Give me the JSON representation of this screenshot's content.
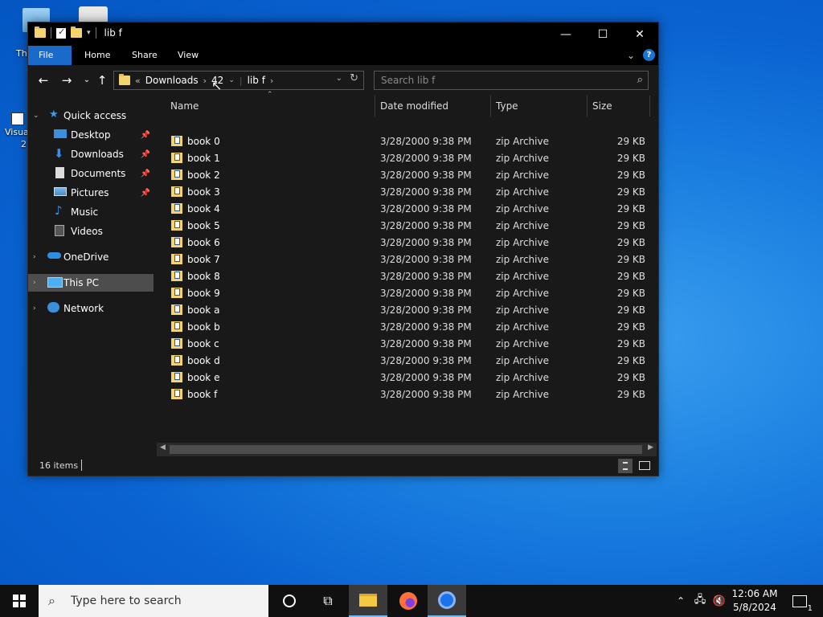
{
  "desktop": {
    "icon_labels": [
      "Th",
      "Visua",
      "2"
    ]
  },
  "window": {
    "title": "lib f",
    "minimize": "—",
    "maximize": "☐",
    "close": "✕"
  },
  "ribbon": {
    "tabs": [
      "File",
      "Home",
      "Share",
      "View"
    ],
    "help": "?"
  },
  "address": {
    "overflow": "«",
    "crumbs": [
      "Downloads",
      "42",
      "lib f"
    ],
    "separator": "›"
  },
  "search": {
    "placeholder": "Search lib f"
  },
  "navpane": {
    "quick_access": "Quick access",
    "desktop": "Desktop",
    "downloads": "Downloads",
    "documents": "Documents",
    "pictures": "Pictures",
    "music": "Music",
    "videos": "Videos",
    "onedrive": "OneDrive",
    "this_pc": "This PC",
    "network": "Network"
  },
  "columns": {
    "name": "Name",
    "date": "Date modified",
    "type": "Type",
    "size": "Size"
  },
  "files": [
    {
      "name": "book 0",
      "date": "3/28/2000 9:38 PM",
      "type": "zip Archive",
      "size": "29 KB"
    },
    {
      "name": "book 1",
      "date": "3/28/2000 9:38 PM",
      "type": "zip Archive",
      "size": "29 KB"
    },
    {
      "name": "book 2",
      "date": "3/28/2000 9:38 PM",
      "type": "zip Archive",
      "size": "29 KB"
    },
    {
      "name": "book 3",
      "date": "3/28/2000 9:38 PM",
      "type": "zip Archive",
      "size": "29 KB"
    },
    {
      "name": "book 4",
      "date": "3/28/2000 9:38 PM",
      "type": "zip Archive",
      "size": "29 KB"
    },
    {
      "name": "book 5",
      "date": "3/28/2000 9:38 PM",
      "type": "zip Archive",
      "size": "29 KB"
    },
    {
      "name": "book 6",
      "date": "3/28/2000 9:38 PM",
      "type": "zip Archive",
      "size": "29 KB"
    },
    {
      "name": "book 7",
      "date": "3/28/2000 9:38 PM",
      "type": "zip Archive",
      "size": "29 KB"
    },
    {
      "name": "book 8",
      "date": "3/28/2000 9:38 PM",
      "type": "zip Archive",
      "size": "29 KB"
    },
    {
      "name": "book 9",
      "date": "3/28/2000 9:38 PM",
      "type": "zip Archive",
      "size": "29 KB"
    },
    {
      "name": "book a",
      "date": "3/28/2000 9:38 PM",
      "type": "zip Archive",
      "size": "29 KB"
    },
    {
      "name": "book b",
      "date": "3/28/2000 9:38 PM",
      "type": "zip Archive",
      "size": "29 KB"
    },
    {
      "name": "book c",
      "date": "3/28/2000 9:38 PM",
      "type": "zip Archive",
      "size": "29 KB"
    },
    {
      "name": "book d",
      "date": "3/28/2000 9:38 PM",
      "type": "zip Archive",
      "size": "29 KB"
    },
    {
      "name": "book e",
      "date": "3/28/2000 9:38 PM",
      "type": "zip Archive",
      "size": "29 KB"
    },
    {
      "name": "book f",
      "date": "3/28/2000 9:38 PM",
      "type": "zip Archive",
      "size": "29 KB"
    }
  ],
  "status": {
    "count": "16 items"
  },
  "taskbar": {
    "search_placeholder": "Type here to search",
    "time": "12:06 AM",
    "date": "5/8/2024",
    "notification_count": "1"
  },
  "colors": {
    "accent": "#1a6ac9",
    "window_bg": "#191919",
    "folder": "#f5d36e"
  }
}
